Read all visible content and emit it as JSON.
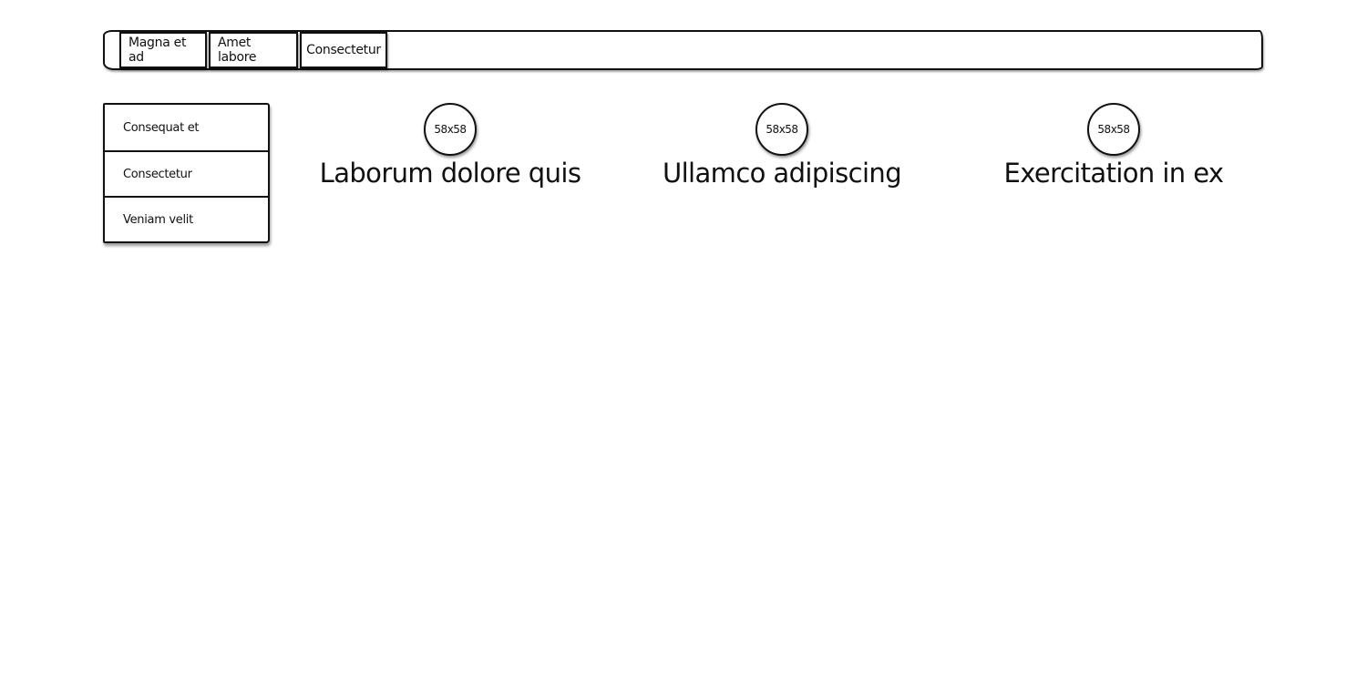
{
  "navbar": {
    "items": [
      {
        "label": "Magna et ad"
      },
      {
        "label": "Amet labore"
      },
      {
        "label": "Consectetur"
      }
    ]
  },
  "sidebar": {
    "items": [
      {
        "label": "Consequat et"
      },
      {
        "label": "Consectetur"
      },
      {
        "label": "Veniam velit"
      }
    ]
  },
  "features": [
    {
      "image_label": "58x58",
      "title": "Laborum dolore quis"
    },
    {
      "image_label": "58x58",
      "title": "Ullamco adipiscing"
    },
    {
      "image_label": "58x58",
      "title": "Exercitation in ex"
    }
  ]
}
